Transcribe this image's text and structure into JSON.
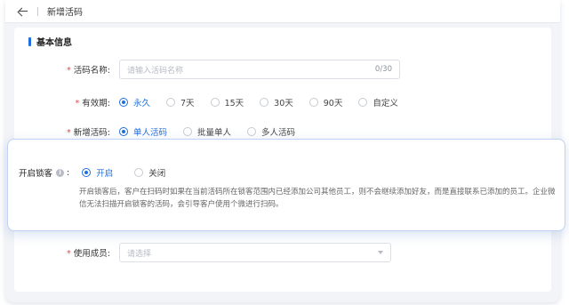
{
  "header": {
    "title": "新增活码"
  },
  "section": {
    "title": "基本信息"
  },
  "fields": {
    "name": {
      "label": "活码名称:",
      "placeholder": "请输入活码名称",
      "counter": "0/30"
    },
    "validity": {
      "label": "有效期:",
      "options": [
        "永久",
        "7天",
        "15天",
        "30天",
        "90天",
        "自定义"
      ],
      "selected": "永久"
    },
    "type": {
      "label": "新增活码:",
      "options": [
        "单人活码",
        "批量单人",
        "多人活码"
      ],
      "selected": "单人活码"
    },
    "lock": {
      "label": "开启锁客",
      "info_icon": "i",
      "colon": ":",
      "options": [
        "开启",
        "关闭"
      ],
      "selected": "开启",
      "description": "开启锁客后，客户在扫码时如果在当前活码所在锁客范围内已经添加公司其他员工，则不会继续添加好友，而是直接联系已添加的员工。企业微信无法扫描开启锁客的活码，会引导客户使用个微进行扫码。"
    },
    "members": {
      "label": "使用成员:",
      "placeholder": "请选择"
    }
  },
  "icons": {
    "back": "back-arrow-icon",
    "info": "info-icon",
    "dropdown": "chevron-down-icon"
  },
  "colors": {
    "accent": "#1f6fe0",
    "required": "#e5484d",
    "panel_border": "#bcd3f3"
  }
}
